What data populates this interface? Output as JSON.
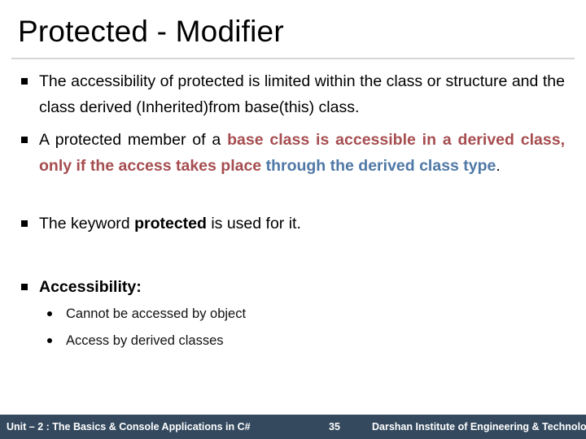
{
  "slide": {
    "title": "Protected - Modifier",
    "bullets": [
      {
        "segments": [
          {
            "text": "The accessibility of protected is limited within the class or structure and the class derived (Inherited)from base(this) class.",
            "style": "normal"
          }
        ]
      },
      {
        "segments": [
          {
            "text": "A protected member of a ",
            "style": "normal"
          },
          {
            "text": "base class is accessible in a derived class, only if the access takes place",
            "style": "red-bold"
          },
          {
            "text": " ",
            "style": "normal"
          },
          {
            "text": "through the derived class type",
            "style": "blue-bold"
          },
          {
            "text": ".",
            "style": "normal"
          }
        ]
      },
      {
        "segments": [
          {
            "text": "The keyword ",
            "style": "normal"
          },
          {
            "text": "protected",
            "style": "bold"
          },
          {
            "text": " is used for it.",
            "style": "normal"
          }
        ]
      },
      {
        "segments": [
          {
            "text": "Accessibility:",
            "style": "bold"
          }
        ],
        "sub_bullets": [
          "Cannot be accessed by object",
          "Access by derived classes"
        ]
      }
    ],
    "colors": {
      "highlight_red": "#a64d50",
      "highlight_blue": "#4f78a6",
      "footer_bg": "#34495e"
    }
  },
  "footer": {
    "unit": "Unit – 2 : The Basics & Console Applications in C#",
    "page_number": "35",
    "institute": "Darshan Institute of Engineering & Technology"
  }
}
